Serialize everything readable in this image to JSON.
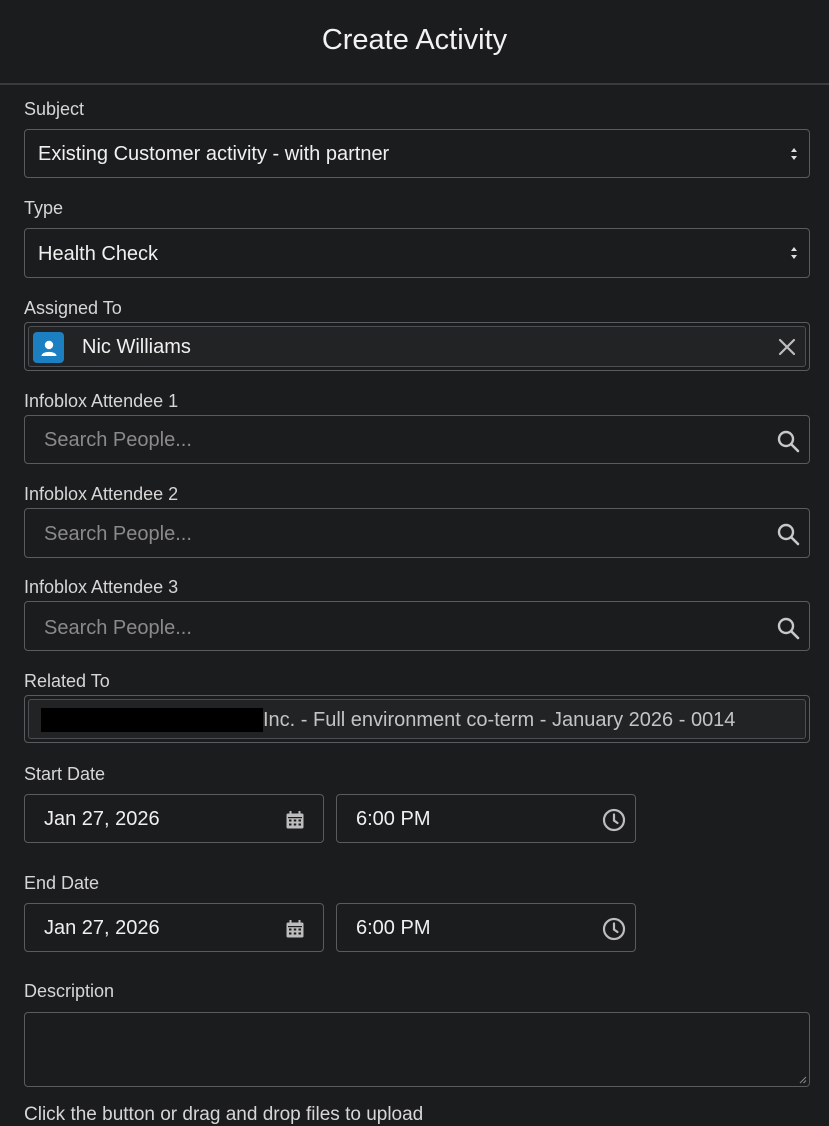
{
  "header": {
    "title": "Create Activity"
  },
  "subject": {
    "label": "Subject",
    "value": "Existing Customer activity - with partner"
  },
  "type": {
    "label": "Type",
    "value": "Health Check"
  },
  "assigned_to": {
    "label": "Assigned To",
    "value": "Nic Williams"
  },
  "attendee1": {
    "label": "Infoblox Attendee 1",
    "placeholder": "Search People..."
  },
  "attendee2": {
    "label": "Infoblox Attendee 2",
    "placeholder": "Search People..."
  },
  "attendee3": {
    "label": "Infoblox Attendee 3",
    "placeholder": "Search People..."
  },
  "related_to": {
    "label": "Related To",
    "value": "Inc. - Full environment co-term - January 2026 - 0014"
  },
  "start": {
    "label": "Start Date",
    "date": "Jan 27, 2026",
    "time": "6:00 PM"
  },
  "end": {
    "label": "End Date",
    "date": "Jan 27, 2026",
    "time": "6:00 PM"
  },
  "description": {
    "label": "Description"
  },
  "upload": {
    "note": "Click the button or drag and drop files to upload"
  },
  "colors": {
    "background": "#1b1c1e",
    "border": "#5a5b5e",
    "avatar": "#1b7fc2"
  }
}
